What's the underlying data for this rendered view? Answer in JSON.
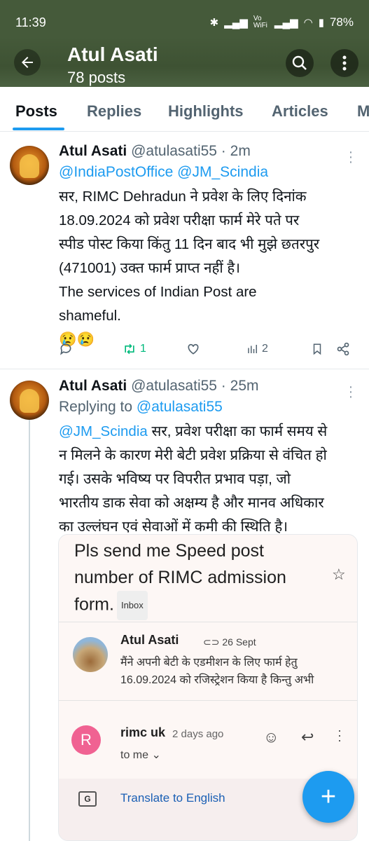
{
  "status_bar": {
    "time": "11:39",
    "network": "Vo WiFi",
    "battery": "78%"
  },
  "header": {
    "title": "Atul Asati",
    "subtitle": "78 posts"
  },
  "tabs": [
    "Posts",
    "Replies",
    "Highlights",
    "Articles",
    "M"
  ],
  "posts": [
    {
      "name": "Atul Asati",
      "handle": "@atulasati55 · 2m",
      "mentions": "@IndiaPostOffice @JM_Scindia",
      "lines": [
        "सर, RIMC Dehradun ने प्रवेश के लिए दिनांक",
        "18.09.2024 को प्रवेश परीक्षा फार्म मेरे पते पर",
        "स्पीड पोस्ट किया किंतु 11 दिन बाद भी मुझे छतरपुर",
        "(471001) उक्त फार्म प्राप्त नहीं है।",
        "The services of Indian Post are",
        "shameful.",
        "😢😢"
      ],
      "retweets": "1",
      "views": "2"
    },
    {
      "name": "Atul Asati",
      "handle": "@atulasati55 · 25m",
      "replying_prefix": "Replying to ",
      "replying_to": "@atulasati55",
      "mention": "@JM_Scindia",
      "lines": [
        "सर, प्रवेश परीक्षा का फार्म समय से",
        "न मिलने के कारण मेरी बेटी प्रवेश प्रक्रिया से वंचित हो",
        "गई। उसके भविष्य पर विपरीत प्रभाव पड़ा, जो",
        "भारतीय डाक सेवा को अक्षम्य है और मानव अधिकार",
        "का उल्लंघन एवं सेवाओं में कमी की स्थिति है।"
      ]
    }
  ],
  "email_card": {
    "subject_lines": [
      "Pls send me Speed post",
      "number of RIMC admission",
      "form."
    ],
    "label": "Inbox",
    "message1": {
      "sender": "Atul Asati",
      "date": "26 Sept",
      "preview_lines": [
        "मैंने अपनी बेटी के एडमीशन के लिए फार्म हेतु",
        "16.09.2024 को रजिस्ट्रेशन किया है किन्तु अभी"
      ]
    },
    "message2": {
      "initial": "R",
      "sender": "rimc uk",
      "time": "2 days ago",
      "to": "to me"
    },
    "translate": "Translate to English"
  },
  "fab": "+"
}
